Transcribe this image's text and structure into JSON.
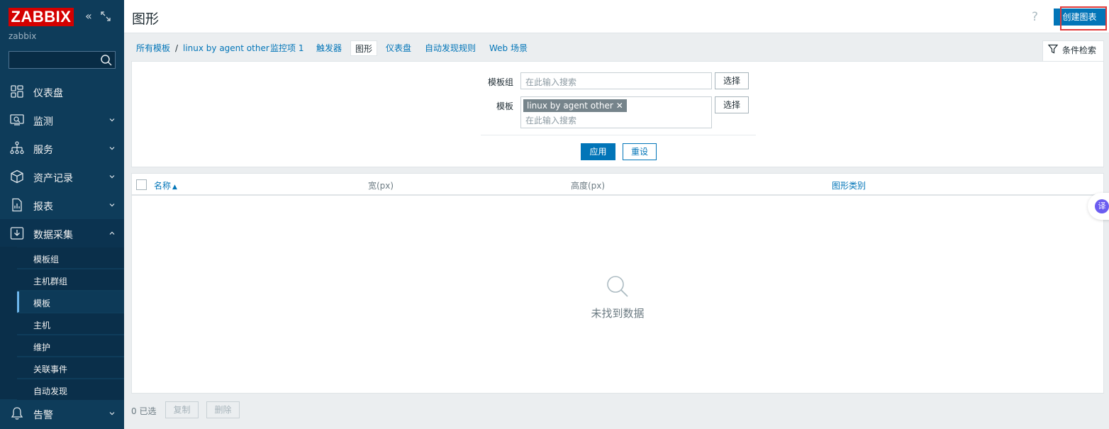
{
  "app": {
    "logo": "ZABBIX",
    "server_name": "zabbix",
    "collapse_glyph": "«"
  },
  "colors": {
    "sidebar_bg": "#0e3c5a",
    "accent": "#0275b8",
    "logo_red": "#d40000",
    "highlight_red": "#e03838"
  },
  "sidebar": {
    "search_placeholder": "",
    "items": [
      {
        "label": "仪表盘",
        "icon": "dashboard-icon"
      },
      {
        "label": "监测",
        "icon": "monitoring-icon"
      },
      {
        "label": "服务",
        "icon": "services-icon"
      },
      {
        "label": "资产记录",
        "icon": "inventory-icon"
      },
      {
        "label": "报表",
        "icon": "reports-icon"
      },
      {
        "label": "数据采集",
        "icon": "data-collection-icon"
      }
    ],
    "submenu": [
      "模板组",
      "主机群组",
      "模板",
      "主机",
      "维护",
      "关联事件",
      "自动发现"
    ],
    "bottom_item": {
      "label": "告警",
      "icon": "alerts-icon"
    }
  },
  "header": {
    "title": "图形",
    "help": "?",
    "create_button": "创建图表"
  },
  "breadcrumb": {
    "items": [
      "所有模板",
      "linux by agent other",
      "监控项 1",
      "触发器",
      "图形",
      "仪表盘",
      "自动发现规则",
      "Web 场景"
    ],
    "separator": "/"
  },
  "filter": {
    "tab_label": "条件检索",
    "template_group_label": "模板组",
    "template_group_placeholder": "在此输入搜索",
    "template_label": "模板",
    "template_tag": "linux by agent other",
    "template_placeholder": "在此输入搜索",
    "select_label": "选择",
    "apply_label": "应用",
    "reset_label": "重设"
  },
  "table": {
    "columns": [
      "名称",
      "宽(px)",
      "高度(px)",
      "图形类别"
    ],
    "sort_indicator": "▲",
    "empty_text": "未找到数据"
  },
  "footer": {
    "selected": "0 已选",
    "copy_label": "复制",
    "delete_label": "删除"
  },
  "translate_fab": {
    "label": "译"
  }
}
